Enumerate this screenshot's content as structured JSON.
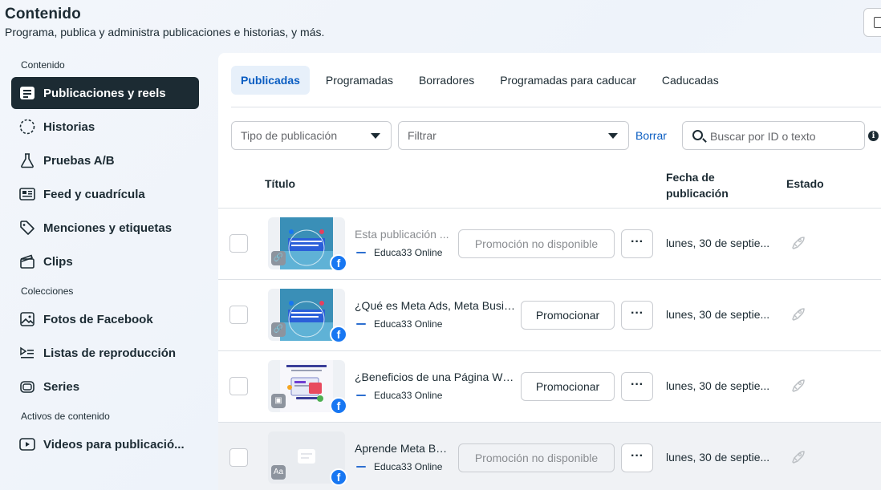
{
  "header": {
    "title": "Contenido",
    "subtitle": "Programa, publica y administra publicaciones e historias, y más."
  },
  "sidebar": {
    "section_content": "Contenido",
    "section_collections": "Colecciones",
    "section_assets": "Activos de contenido",
    "items": [
      {
        "label": "Publicaciones y reels",
        "icon": "posts-icon",
        "active": true
      },
      {
        "label": "Historias",
        "icon": "stories-icon"
      },
      {
        "label": "Pruebas A/B",
        "icon": "flask-icon"
      },
      {
        "label": "Feed y cuadrícula",
        "icon": "feed-grid-icon"
      },
      {
        "label": "Menciones y etiquetas",
        "icon": "tag-icon"
      },
      {
        "label": "Clips",
        "icon": "clapper-icon"
      },
      {
        "label": "Fotos de Facebook",
        "icon": "photo-icon"
      },
      {
        "label": "Listas de reproducción",
        "icon": "playlist-icon"
      },
      {
        "label": "Series",
        "icon": "series-icon"
      },
      {
        "label": "Videos para publicació...",
        "icon": "video-icon"
      }
    ]
  },
  "tabs": [
    {
      "label": "Publicadas",
      "active": true
    },
    {
      "label": "Programadas"
    },
    {
      "label": "Borradores"
    },
    {
      "label": "Programadas para caducar"
    },
    {
      "label": "Caducadas"
    }
  ],
  "filters": {
    "post_type_placeholder": "Tipo de publicación",
    "filter_placeholder": "Filtrar",
    "clear_label": "Borrar",
    "search_placeholder": "Buscar por ID o texto"
  },
  "table": {
    "col_title": "Título",
    "col_date": "Fecha de publicación",
    "col_status": "Estado",
    "rows": [
      {
        "title": "Esta publicación ...",
        "title_muted": true,
        "page": "Educa33 Online",
        "action": "Promoción no disponible",
        "action_disabled": true,
        "date": "lunes, 30 de septie...",
        "thumb_badge": "link-icon"
      },
      {
        "title": "¿Qué es Meta Ads, Meta Busin...",
        "page": "Educa33 Online",
        "action": "Promocionar",
        "action_disabled": false,
        "date": "lunes, 30 de septie...",
        "thumb_badge": "link-icon"
      },
      {
        "title": "¿Beneficios de una Página We...",
        "page": "Educa33 Online",
        "action": "Promocionar",
        "action_disabled": false,
        "date": "lunes, 30 de septie...",
        "thumb_badge": "image-icon"
      },
      {
        "title": "Aprende Meta Bu...",
        "page": "Educa33 Online",
        "action": "Promoción no disponible",
        "action_disabled": true,
        "date": "lunes, 30 de septie...",
        "thumb_badge": "text-icon"
      }
    ]
  },
  "colors": {
    "accent": "#0a5dc2",
    "active_nav": "#1c2b33",
    "facebook_blue": "#1877f2"
  }
}
